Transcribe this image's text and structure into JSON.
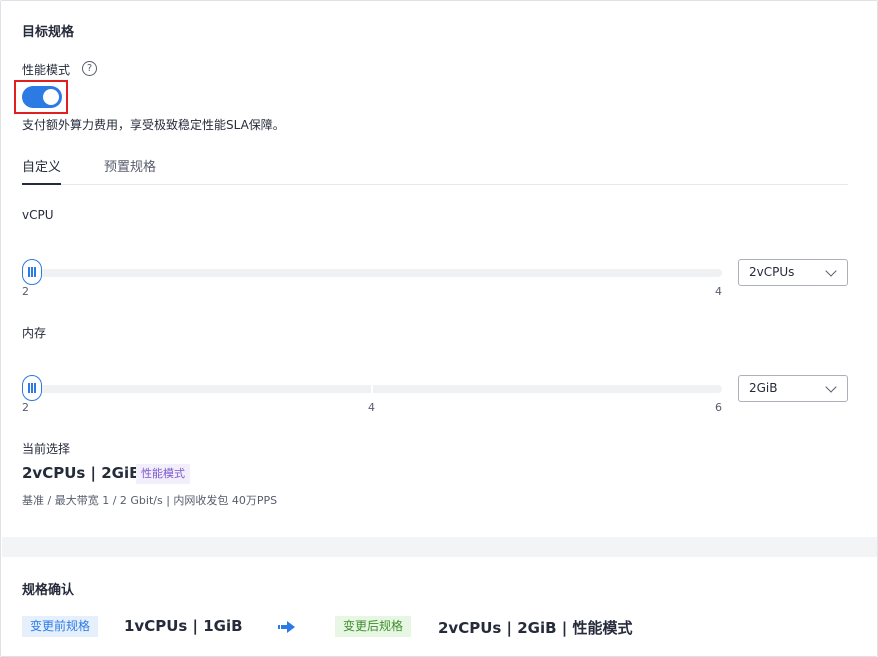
{
  "target_spec": {
    "title": "目标规格",
    "perf_mode_label": "性能模式",
    "help_glyph": "?",
    "perf_mode_enabled": true,
    "perf_mode_desc": "支付额外算力费用，享受极致稳定性能SLA保障。"
  },
  "tabs": [
    {
      "label": "自定义",
      "active": true
    },
    {
      "label": "预置规格",
      "active": false
    }
  ],
  "vcpu": {
    "label": "vCPU",
    "min": 2,
    "max": 4,
    "value": 2,
    "ticks": [
      "2",
      "4"
    ],
    "select_value": "2vCPUs"
  },
  "memory": {
    "label": "内存",
    "min": 2,
    "max": 6,
    "value": 2,
    "ticks": [
      "2",
      "4",
      "6"
    ],
    "select_value": "2GiB"
  },
  "current": {
    "label": "当前选择",
    "value": "2vCPUs | 2GiB",
    "badge": "性能模式",
    "specs": "基准 / 最大带宽   1 / 2 Gbit/s  |  内网收发包  40万PPS"
  },
  "confirm": {
    "title": "规格确认",
    "before_label": "变更前规格",
    "before_value": "1vCPUs | 1GiB",
    "after_label": "变更后规格",
    "after_value": "2vCPUs | 2GiB | 性能模式"
  },
  "colors": {
    "accent": "#2c7be5",
    "highlight_border": "#e02020",
    "perf_badge": "#7b57d1",
    "after_badge": "#3f8f2e"
  }
}
